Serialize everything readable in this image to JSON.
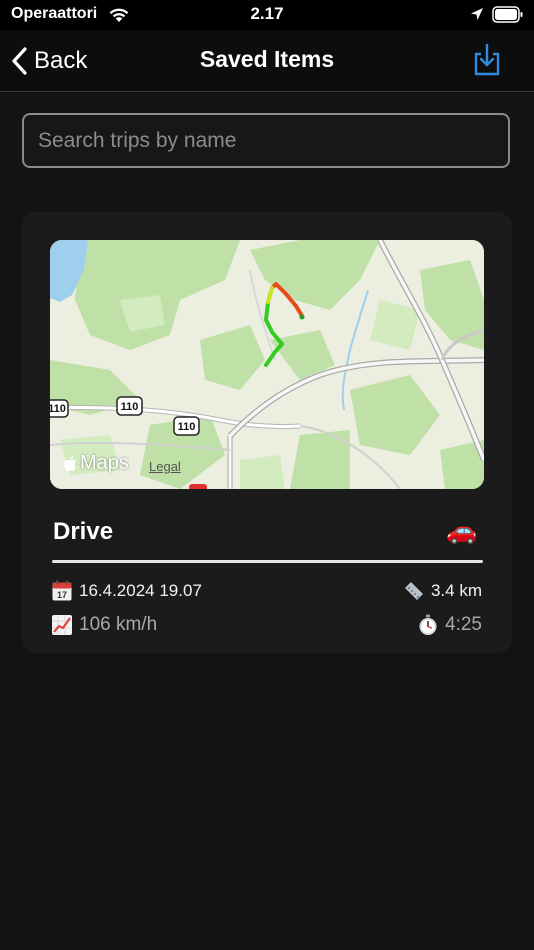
{
  "status_bar": {
    "carrier": "Operaattori",
    "time": "2.17"
  },
  "nav": {
    "back_label": "Back",
    "title": "Saved Items"
  },
  "search": {
    "placeholder": "Search trips by name",
    "value": ""
  },
  "trips": [
    {
      "name": "Drive",
      "emoji": "🚗",
      "date": "16.4.2024 19.07",
      "max_speed": "106 km/h",
      "distance": "3.4 km",
      "duration": "4:25",
      "map": {
        "road_labels": [
          "110",
          "110",
          "110"
        ],
        "brand": "Maps",
        "legal": "Legal"
      }
    }
  ],
  "icons": {
    "date": "calendar-icon",
    "speed": "chart-increasing-icon",
    "distance": "ruler-icon",
    "duration": "stopwatch-icon",
    "download": "download-tray-icon"
  },
  "colors": {
    "accent": "#2f8ce0",
    "background": "#131313",
    "card": "#1b1b1b"
  }
}
